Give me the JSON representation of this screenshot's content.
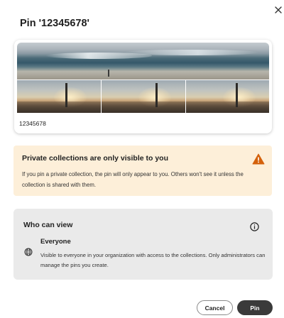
{
  "dialog": {
    "title": "Pin '12345678'",
    "close_icon": "close-icon"
  },
  "preview": {
    "caption": "12345678"
  },
  "alert": {
    "title": "Private collections are only visible to you",
    "body": "If you pin a private collection, the pin will only appear to you. Others won't see it unless the collection is shared with them.",
    "icon": "warning-icon",
    "icon_color": "#d4610b",
    "background": "#fdefd9"
  },
  "visibility": {
    "title": "Who can view",
    "info_icon": "info-icon",
    "option_icon": "globe-icon",
    "option_label": "Everyone",
    "option_description": "Visible to everyone in your organization with access to the collections. Only administrators can manage the pins you create."
  },
  "actions": {
    "cancel_label": "Cancel",
    "pin_label": "Pin"
  }
}
